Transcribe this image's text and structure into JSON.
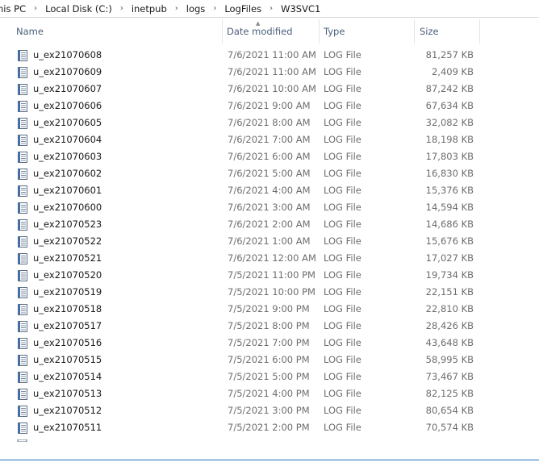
{
  "breadcrumb": [
    "nis PC",
    "Local Disk (C:)",
    "inetpub",
    "logs",
    "LogFiles",
    "W3SVC1"
  ],
  "columns": {
    "name": "Name",
    "date": "Date modified",
    "type": "Type",
    "size": "Size"
  },
  "icons": {
    "file": "log-file-icon",
    "separator": "chevron-right-icon",
    "sort": "sort-up-icon"
  },
  "files": [
    {
      "name": "u_ex21070608",
      "date": "7/6/2021 11:00 AM",
      "type": "LOG File",
      "size": "81,257 KB"
    },
    {
      "name": "u_ex21070609",
      "date": "7/6/2021 11:00 AM",
      "type": "LOG File",
      "size": "2,409 KB"
    },
    {
      "name": "u_ex21070607",
      "date": "7/6/2021 10:00 AM",
      "type": "LOG File",
      "size": "87,242 KB"
    },
    {
      "name": "u_ex21070606",
      "date": "7/6/2021 9:00 AM",
      "type": "LOG File",
      "size": "67,634 KB"
    },
    {
      "name": "u_ex21070605",
      "date": "7/6/2021 8:00 AM",
      "type": "LOG File",
      "size": "32,082 KB"
    },
    {
      "name": "u_ex21070604",
      "date": "7/6/2021 7:00 AM",
      "type": "LOG File",
      "size": "18,198 KB"
    },
    {
      "name": "u_ex21070603",
      "date": "7/6/2021 6:00 AM",
      "type": "LOG File",
      "size": "17,803 KB"
    },
    {
      "name": "u_ex21070602",
      "date": "7/6/2021 5:00 AM",
      "type": "LOG File",
      "size": "16,830 KB"
    },
    {
      "name": "u_ex21070601",
      "date": "7/6/2021 4:00 AM",
      "type": "LOG File",
      "size": "15,376 KB"
    },
    {
      "name": "u_ex21070600",
      "date": "7/6/2021 3:00 AM",
      "type": "LOG File",
      "size": "14,594 KB"
    },
    {
      "name": "u_ex21070523",
      "date": "7/6/2021 2:00 AM",
      "type": "LOG File",
      "size": "14,686 KB"
    },
    {
      "name": "u_ex21070522",
      "date": "7/6/2021 1:00 AM",
      "type": "LOG File",
      "size": "15,676 KB"
    },
    {
      "name": "u_ex21070521",
      "date": "7/6/2021 12:00 AM",
      "type": "LOG File",
      "size": "17,027 KB"
    },
    {
      "name": "u_ex21070520",
      "date": "7/5/2021 11:00 PM",
      "type": "LOG File",
      "size": "19,734 KB"
    },
    {
      "name": "u_ex21070519",
      "date": "7/5/2021 10:00 PM",
      "type": "LOG File",
      "size": "22,151 KB"
    },
    {
      "name": "u_ex21070518",
      "date": "7/5/2021 9:00 PM",
      "type": "LOG File",
      "size": "22,810 KB"
    },
    {
      "name": "u_ex21070517",
      "date": "7/5/2021 8:00 PM",
      "type": "LOG File",
      "size": "28,426 KB"
    },
    {
      "name": "u_ex21070516",
      "date": "7/5/2021 7:00 PM",
      "type": "LOG File",
      "size": "43,648 KB"
    },
    {
      "name": "u_ex21070515",
      "date": "7/5/2021 6:00 PM",
      "type": "LOG File",
      "size": "58,995 KB"
    },
    {
      "name": "u_ex21070514",
      "date": "7/5/2021 5:00 PM",
      "type": "LOG File",
      "size": "73,467 KB"
    },
    {
      "name": "u_ex21070513",
      "date": "7/5/2021 4:00 PM",
      "type": "LOG File",
      "size": "82,125 KB"
    },
    {
      "name": "u_ex21070512",
      "date": "7/5/2021 3:00 PM",
      "type": "LOG File",
      "size": "80,654 KB"
    },
    {
      "name": "u_ex21070511",
      "date": "7/5/2021 2:00 PM",
      "type": "LOG File",
      "size": "70,574 KB"
    }
  ]
}
